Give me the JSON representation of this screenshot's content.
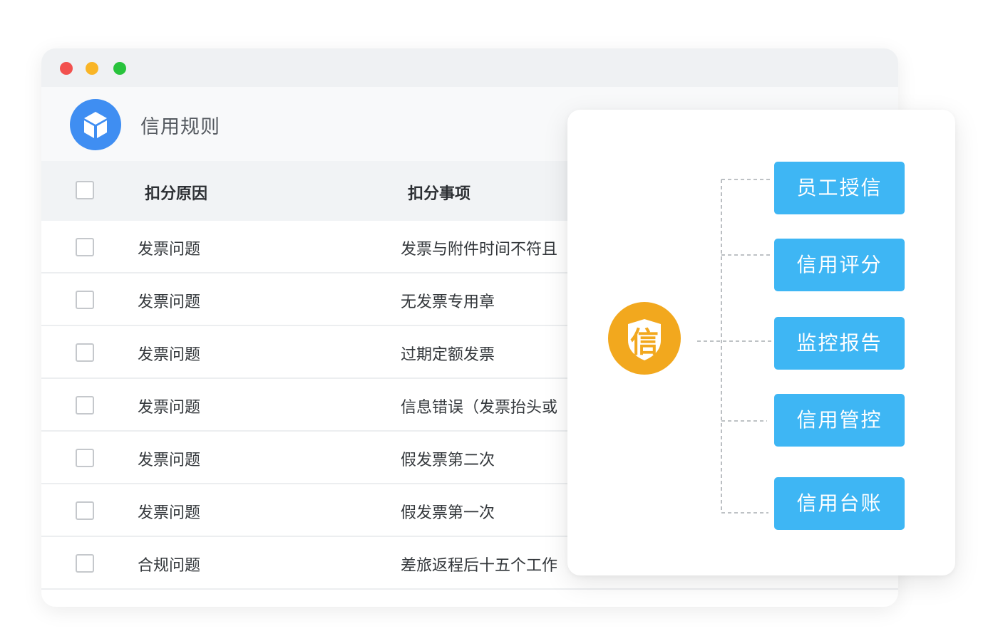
{
  "app": {
    "title": "信用规则"
  },
  "table": {
    "columns": [
      "扣分原因",
      "扣分事项"
    ],
    "rows": [
      {
        "reason": "发票问题",
        "item": "发票与附件时间不符且"
      },
      {
        "reason": "发票问题",
        "item": "无发票专用章"
      },
      {
        "reason": "发票问题",
        "item": "过期定额发票"
      },
      {
        "reason": "发票问题",
        "item": "信息错误（发票抬头或"
      },
      {
        "reason": "发票问题",
        "item": "假发票第二次"
      },
      {
        "reason": "发票问题",
        "item": "假发票第一次"
      },
      {
        "reason": "合规问题",
        "item": "差旅返程后十五个工作"
      }
    ]
  },
  "credit_panel": {
    "badge_char": "信",
    "features": [
      "员工授信",
      "信用评分",
      "监控报告",
      "信用管控",
      "信用台账"
    ]
  },
  "colors": {
    "titlebar": "#eff1f3",
    "close_dot": "#f2514e",
    "minimize_dot": "#f9b526",
    "maximize_dot": "#28c33c",
    "logo": "#3f8ef2",
    "badge": "#f2a81e",
    "feature_button": "#3eb6f4"
  },
  "icons": {
    "logo": "cube-icon",
    "badge": "shield-icon"
  }
}
